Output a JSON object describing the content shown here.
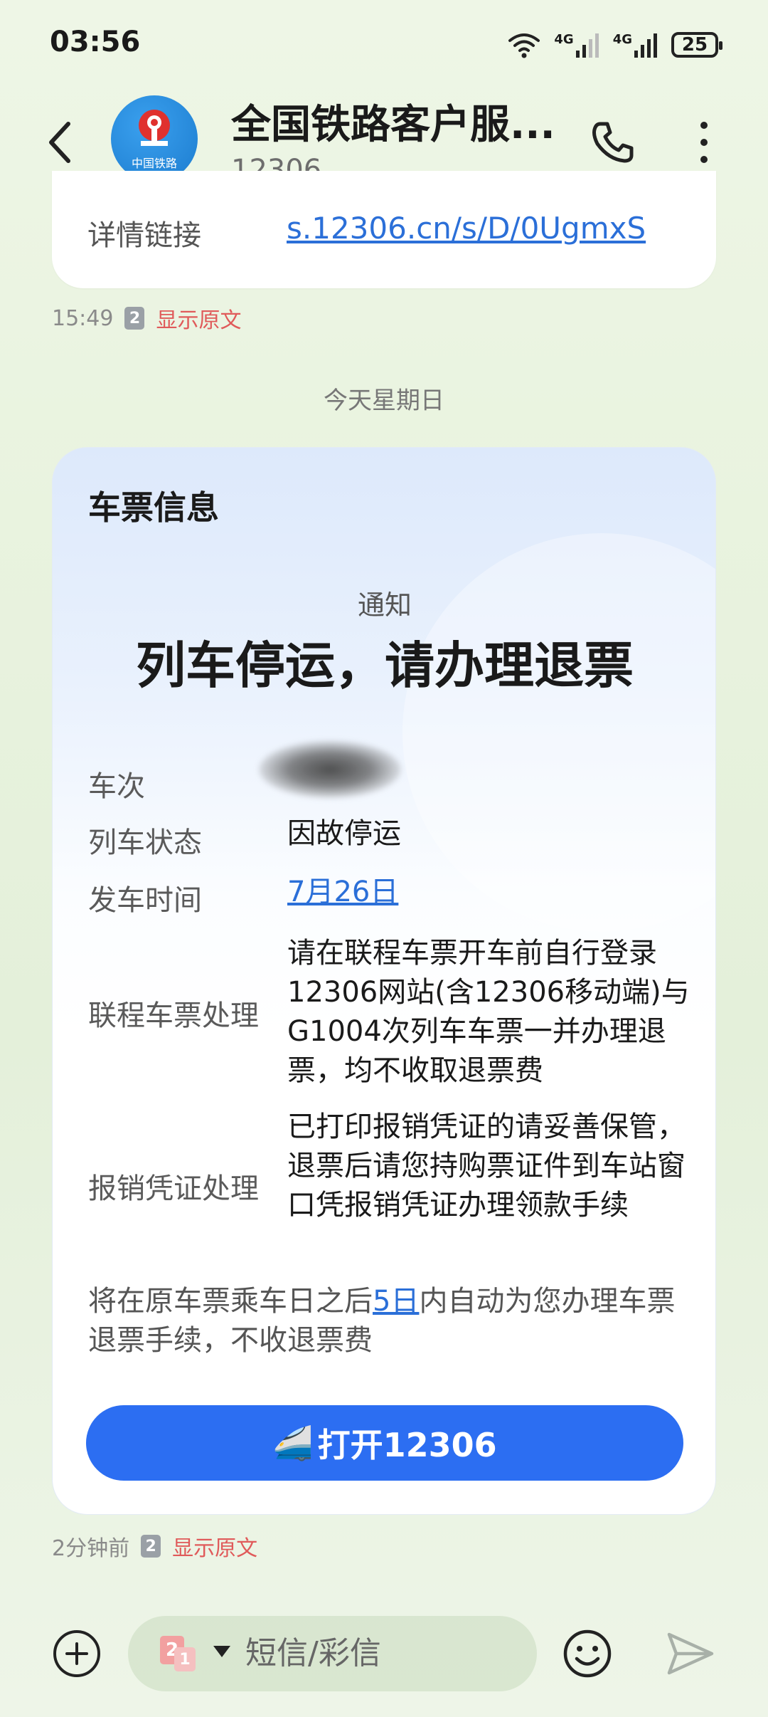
{
  "status_bar": {
    "time": "03:56",
    "signal1": "4G",
    "signal2": "4G",
    "battery": "25"
  },
  "header": {
    "contact_name": "全国铁路客户服...",
    "number": "12306",
    "avatar_text": "中国铁路"
  },
  "prev_message": {
    "label": "详情链接",
    "link": "s.12306.cn/s/D/0UgmxS",
    "time": "15:49",
    "sim": "2",
    "show_original": "显示原文"
  },
  "date_separator": "今天星期日",
  "card": {
    "title": "车票信息",
    "notice": "通知",
    "headline": "列车停运，请办理退票",
    "rows": [
      {
        "label": "车次",
        "value": ""
      },
      {
        "label": "列车状态",
        "value": "因故停运"
      },
      {
        "label": "发车时间",
        "value": "7月26日"
      },
      {
        "label": "联程车票处理",
        "value": "请在联程车票开车前自行登录12306网站(含12306移动端)与G1004次列车车票一并办理退票，均不收取退票费"
      },
      {
        "label": "报销凭证处理",
        "value": "已打印报销凭证的请妥善保管，退票后请您持购票证件到车站窗口凭报销凭证办理领款手续"
      }
    ],
    "footnote_before": "将在原车票乘车日之后",
    "footnote_days": "5日",
    "footnote_after": "内自动为您办理车票退票手续，不收退票费",
    "button_icon": "🚄",
    "button_label": "打开12306"
  },
  "card_meta": {
    "time": "2分钟前",
    "sim": "2",
    "show_original": "显示原文"
  },
  "composer": {
    "placeholder": "短信/彩信",
    "sim_badge_1": "2",
    "sim_badge_2": "1"
  },
  "colors": {
    "accent": "#2c6ef2",
    "link": "#2b6fd8",
    "show_original": "#e05a5a"
  }
}
